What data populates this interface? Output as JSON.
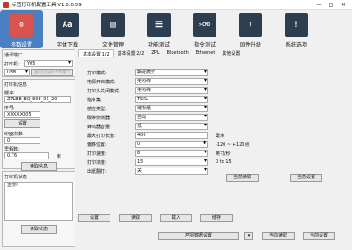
{
  "window": {
    "title": "标签打印机配置工具 V1.0.0.59",
    "minimize": "—",
    "maximize": "□",
    "close": "✕"
  },
  "toolbar": [
    {
      "label": "参数设置",
      "icon": "gear-icon",
      "glyph": "⚙"
    },
    {
      "label": "字体下载",
      "icon": "font-icon",
      "glyph": "Aa"
    },
    {
      "label": "文件管理",
      "icon": "file-icon",
      "glyph": "▤"
    },
    {
      "label": "功能测试",
      "icon": "list-icon",
      "glyph": "☰"
    },
    {
      "label": "指令测试",
      "icon": "command-icon",
      "glyph": ">CMD"
    },
    {
      "label": "固件升级",
      "icon": "upgrade-icon",
      "glyph": "⬆"
    },
    {
      "label": "系统选项",
      "icon": "alert-icon",
      "glyph": "!"
    }
  ],
  "left": {
    "comm": {
      "title": "通讯端口",
      "printer_label": "打印机:",
      "printer_value": "Y05",
      "port_value": "USB",
      "auto_detect_label": "自动识别USB端口"
    },
    "printer_info": {
      "title": "打印机信息",
      "version_label": "版本:",
      "version_value": "ZPLBE_BQ_808_01_20",
      "serial_label": "序号:",
      "serial_value": "XXXXX005",
      "serial_btn": "设置",
      "head_count_label": "印面次数:",
      "head_count_value": "0",
      "mileage_label": "里程数:",
      "mileage_value": "0.76",
      "mileage_unit": "米",
      "read_btn": "读取信息"
    },
    "status": {
      "title": "打印机状态",
      "text": "正常!",
      "read_btn": "读取状态"
    }
  },
  "tabs": [
    "基本设置 1/2",
    "基本设置 2/2",
    "ZPL",
    "Bluetooth",
    "Ethernet",
    "其他设置"
  ],
  "form": [
    {
      "label": "打印模式:",
      "value": "撕纸模式",
      "kind": "combo",
      "hint": ""
    },
    {
      "label": "电源开启模式:",
      "value": "无动作",
      "kind": "combo",
      "hint": ""
    },
    {
      "label": "打印头关闭模式:",
      "value": "无动作",
      "kind": "combo",
      "hint": ""
    },
    {
      "label": "指令集:",
      "value": "TSPL",
      "kind": "combo",
      "hint": ""
    },
    {
      "label": "感应类型:",
      "value": "缝标纸",
      "kind": "combo",
      "hint": ""
    },
    {
      "label": "碳带侦测器:",
      "value": "自动",
      "kind": "combo",
      "hint": ""
    },
    {
      "label": "蜂鸣器音量:",
      "value": "低",
      "kind": "combo",
      "hint": ""
    },
    {
      "label": "最大打印长度:",
      "value": "400",
      "kind": "field",
      "hint": "毫米"
    },
    {
      "label": "偏移位置:",
      "value": "0",
      "kind": "spin",
      "hint": "-120 ~ +120点"
    },
    {
      "label": "打印速度:",
      "value": "8",
      "kind": "combo",
      "hint": "英寸/秒"
    },
    {
      "label": "打印浓度:",
      "value": "15",
      "kind": "combo",
      "hint": "0 to 15"
    },
    {
      "label": "出纸翻打:",
      "value": "关",
      "kind": "combo",
      "hint": ""
    }
  ],
  "actions": {
    "read_current": "当前读取",
    "current_settings": "当前设置",
    "settings": "设置",
    "read": "读取",
    "load": "载入",
    "save": "储存",
    "dropdown_label": "芦坝数据设置",
    "read_all": "当前读取",
    "set_all": "当前设置"
  }
}
